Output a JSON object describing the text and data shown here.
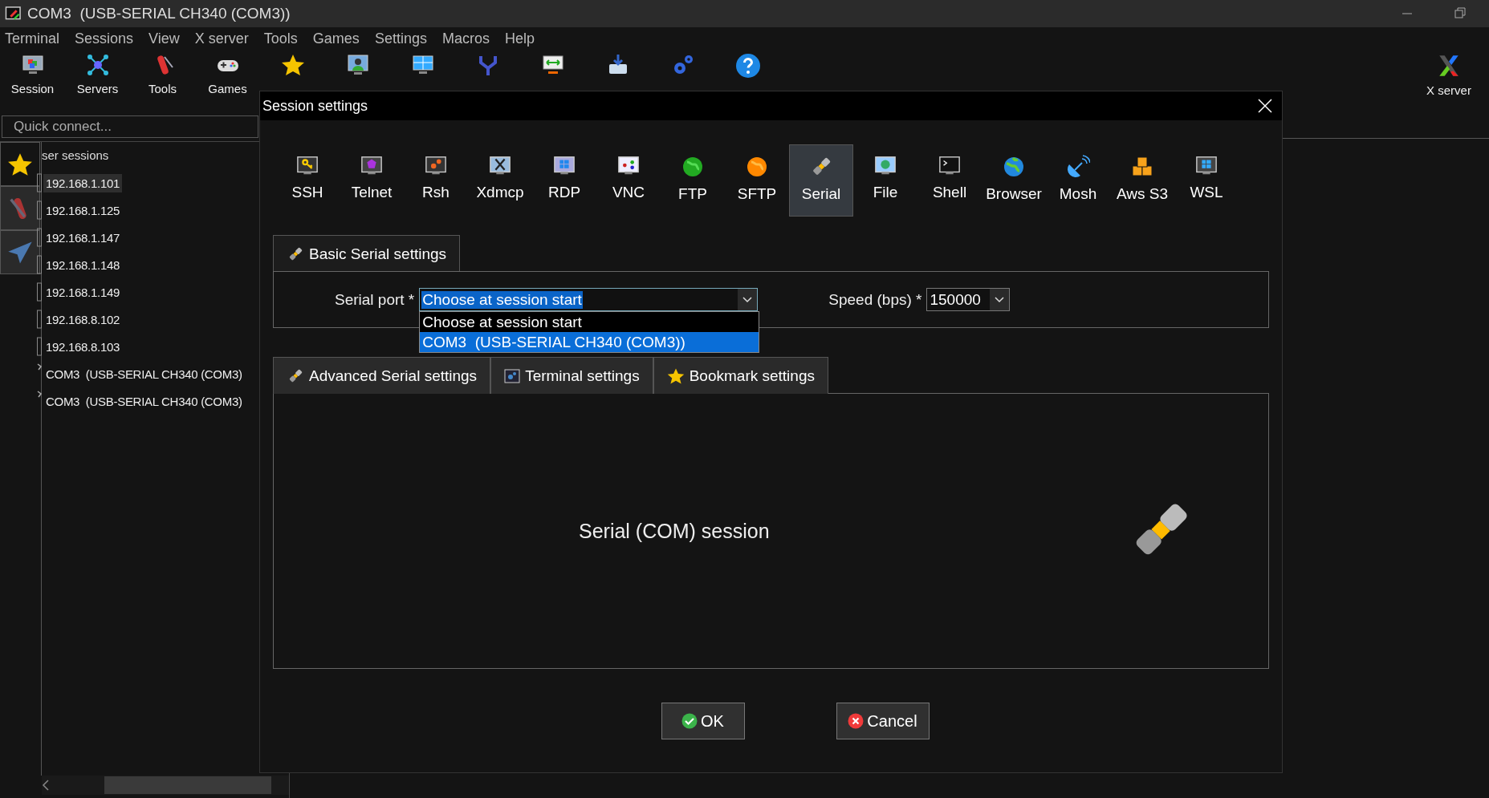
{
  "window": {
    "title": "COM3  (USB-SERIAL CH340 (COM3))"
  },
  "menu": [
    "Terminal",
    "Sessions",
    "View",
    "X server",
    "Tools",
    "Games",
    "Settings",
    "Macros",
    "Help"
  ],
  "toolbar": [
    {
      "kind": "session",
      "label": "Session"
    },
    {
      "kind": "servers",
      "label": "Servers"
    },
    {
      "kind": "tools",
      "label": "Tools"
    },
    {
      "kind": "games",
      "label": "Games"
    },
    {
      "kind": "star"
    },
    {
      "kind": "viewer"
    },
    {
      "kind": "split"
    },
    {
      "kind": "fork"
    },
    {
      "kind": "tunnel"
    },
    {
      "kind": "packages"
    },
    {
      "kind": "gears"
    },
    {
      "kind": "help"
    }
  ],
  "xserver": {
    "label": "X server"
  },
  "sidebar": {
    "quick_connect": {
      "placeholder": "Quick connect..."
    },
    "tabs": [
      {
        "kind": "star",
        "selected": true
      },
      {
        "kind": "tools",
        "selected": false
      },
      {
        "kind": "send",
        "selected": false
      }
    ],
    "header": "ser sessions",
    "items": [
      {
        "kind": "ssh",
        "label": "192.168.1.101",
        "selected": true
      },
      {
        "kind": "ssh",
        "label": "192.168.1.125",
        "selected": false
      },
      {
        "kind": "ssh",
        "label": "192.168.1.147",
        "selected": false
      },
      {
        "kind": "ssh",
        "label": "192.168.1.148",
        "selected": false
      },
      {
        "kind": "ssh",
        "label": "192.168.1.149",
        "selected": false
      },
      {
        "kind": "ssh",
        "label": "192.168.8.102",
        "selected": false
      },
      {
        "kind": "ssh",
        "label": "192.168.8.103",
        "selected": false
      },
      {
        "kind": "serial",
        "label": "COM3  (USB-SERIAL CH340 (COM3)",
        "selected": false
      },
      {
        "kind": "serial",
        "label": "COM3  (USB-SERIAL CH340 (COM3)",
        "selected": false
      }
    ]
  },
  "dialog": {
    "title": "Session settings",
    "session_types": [
      {
        "kind": "ssh",
        "label": "SSH",
        "selected": false
      },
      {
        "kind": "telnet",
        "label": "Telnet",
        "selected": false
      },
      {
        "kind": "rsh",
        "label": "Rsh",
        "selected": false
      },
      {
        "kind": "xdmcp",
        "label": "Xdmcp",
        "selected": false
      },
      {
        "kind": "rdp",
        "label": "RDP",
        "selected": false
      },
      {
        "kind": "vnc",
        "label": "VNC",
        "selected": false
      },
      {
        "kind": "ftp",
        "label": "FTP",
        "selected": false
      },
      {
        "kind": "sftp",
        "label": "SFTP",
        "selected": false
      },
      {
        "kind": "serial",
        "label": "Serial",
        "selected": true
      },
      {
        "kind": "file",
        "label": "File",
        "selected": false
      },
      {
        "kind": "shell",
        "label": "Shell",
        "selected": false
      },
      {
        "kind": "browser",
        "label": "Browser",
        "selected": false
      },
      {
        "kind": "mosh",
        "label": "Mosh",
        "selected": false
      },
      {
        "kind": "aws",
        "label": "Aws S3",
        "selected": false
      },
      {
        "kind": "wsl",
        "label": "WSL",
        "selected": false
      }
    ],
    "basic_tab": {
      "label": "Basic Serial settings",
      "selected": true
    },
    "serial_port": {
      "label": "Serial port *",
      "value": "Choose at session start",
      "options": [
        {
          "label": "Choose at session start",
          "highlighted": false
        },
        {
          "label": "COM3  (USB-SERIAL CH340 (COM3))",
          "highlighted": true
        }
      ]
    },
    "speed": {
      "label": "Speed (bps) *",
      "value": "150000"
    },
    "tabs": [
      {
        "kind": "serial",
        "label": "Advanced Serial settings",
        "selected": false
      },
      {
        "kind": "terminal",
        "label": "Terminal settings",
        "selected": false
      },
      {
        "kind": "star",
        "label": "Bookmark settings",
        "selected": false
      }
    ],
    "panel_text": "Serial (COM) session",
    "buttons": [
      {
        "kind": "ok",
        "label": "OK"
      },
      {
        "kind": "cancel",
        "label": "Cancel"
      }
    ]
  }
}
